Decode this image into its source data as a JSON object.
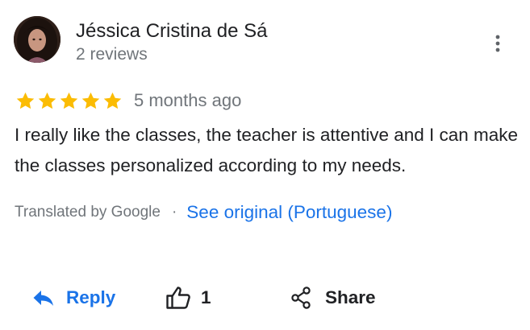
{
  "review": {
    "author": {
      "name": "Jéssica Cristina de Sá",
      "reviews": "2 reviews",
      "avatar": "avatar-photo"
    },
    "menu_icon": "more-vert-icon",
    "rating": 5,
    "max_rating": 5,
    "star_color": "#fbbc04",
    "date": "5 months ago",
    "text": "I really like the classes, the teacher is attentive and I can make the classes personalized according to my needs.",
    "translation": {
      "translated_by": "Translated by Google",
      "separator": "·",
      "see_original": "See original (Portuguese)"
    },
    "actions": {
      "reply": {
        "label": "Reply",
        "icon": "reply-icon"
      },
      "like": {
        "count": "1",
        "icon": "thumbs-up-icon"
      },
      "share": {
        "label": "Share",
        "icon": "share-icon"
      }
    }
  },
  "colors": {
    "link": "#1a73e8",
    "secondary_text": "#70757a",
    "primary_text": "#202124"
  }
}
